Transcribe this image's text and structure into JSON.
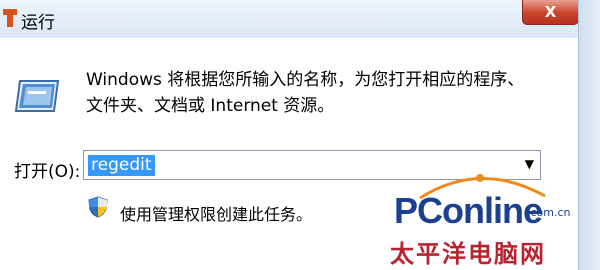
{
  "window": {
    "title": "运行",
    "close_label": "X",
    "close_color": "#c9442c"
  },
  "description": {
    "line1": "Windows 将根据您所输入的名称，为您打开相应的程序、",
    "line2": "文件夹、文档或 Internet 资源。"
  },
  "open_field": {
    "label": "打开(O):",
    "value": "regedit",
    "selection_color": "#3399ff"
  },
  "admin_note": {
    "text": "使用管理权限创建此任务。"
  },
  "watermark": {
    "brand_pc": "PC",
    "brand_rest": "online",
    "domain": ".com.cn",
    "cn_name": "太平洋电脑网",
    "brand_color": "#1b3f91",
    "cn_color": "#b8232f"
  },
  "icons": {
    "app": "run-app-icon",
    "run": "run-dialog-icon",
    "shield": "uac-shield-icon",
    "dropdown": "chevron-down-icon"
  }
}
